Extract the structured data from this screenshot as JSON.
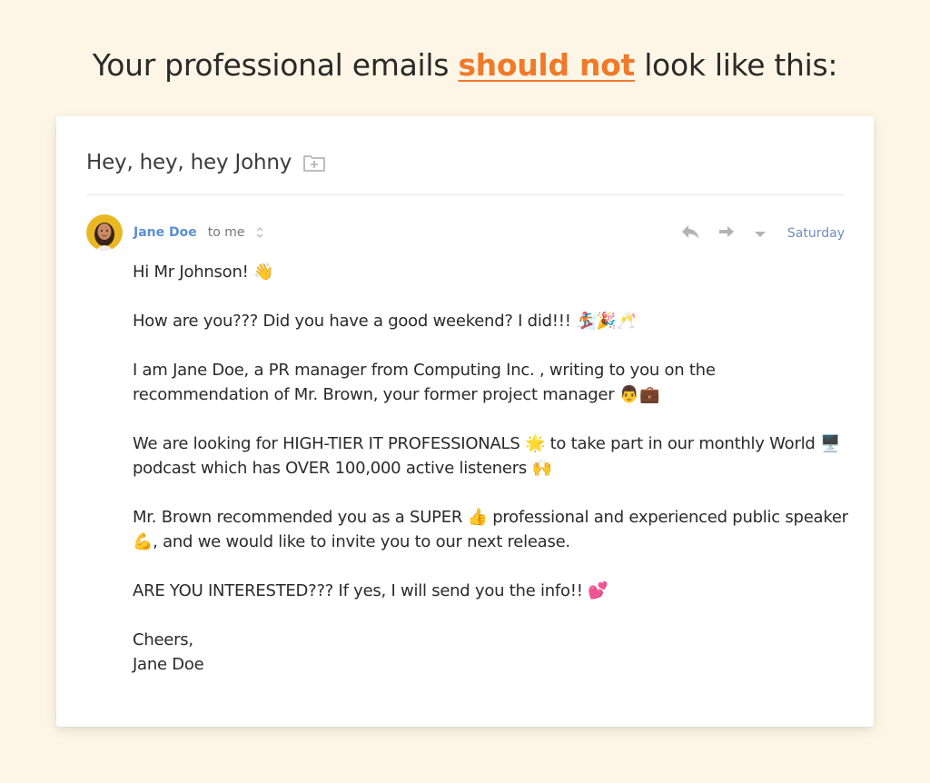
{
  "headline": {
    "prefix": "Your professional emails ",
    "accent": "should not",
    "suffix": " look like this:"
  },
  "email": {
    "subject": "Hey, hey, hey Johny",
    "sender": "Jane Doe",
    "recipient": "to me",
    "date": "Saturday",
    "icons": {
      "folder": "folder-plus-icon",
      "reply": "reply-icon",
      "forward": "forward-icon",
      "more": "dropdown-caret-icon",
      "recipient_toggle": "expand-collapse-icon"
    },
    "body": {
      "p1": "Hi Mr Johnson! 👋",
      "p2": "How are you??? Did you have a good weekend? I did!!! 🏂🎉🥂",
      "p3": "I am Jane Doe, a PR manager from Computing Inc. , writing to you on the recommendation of Mr. Brown, your former project manager 👨💼",
      "p4": "We are looking for HIGH-TIER IT PROFESSIONALS 🌟 to take part in our monthly World 🖥️ podcast which has OVER 100,000 active listeners 🙌",
      "p5": "Mr. Brown recommended you as a SUPER 👍 professional and experienced public speaker 💪, and we would like to invite you to our next release.",
      "p6": "ARE YOU INTERESTED??? If yes, I will send you the info!! 💕",
      "closing": "Cheers,",
      "signature": "Jane Doe"
    }
  },
  "colors": {
    "background": "#fdf6e6",
    "accent": "#f07a2a",
    "sender": "#5a8fd6",
    "date": "#6d8fbd"
  }
}
